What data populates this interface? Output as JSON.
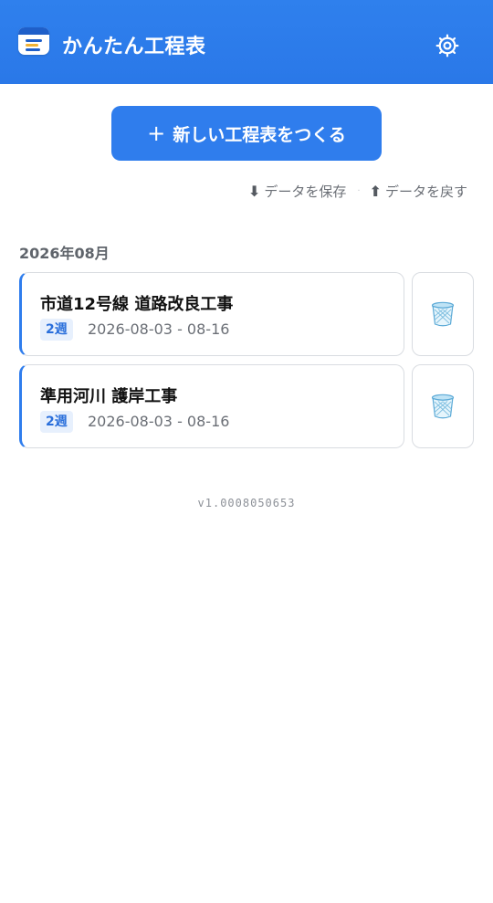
{
  "header": {
    "app_title": "かんたん工程表",
    "app_icon": "calendar-icon",
    "settings_icon": "gear-icon",
    "color": "#2f80ed"
  },
  "actions": {
    "new_button_icon": "+",
    "new_button_label": "新しい工程表をつくる",
    "save_icon": "⬇",
    "save_label": "データを保存",
    "separator": "·",
    "restore_icon": "⬆",
    "restore_label": "データを戻す"
  },
  "month_group": {
    "label": "2026年08月"
  },
  "projects": [
    {
      "title": "市道12号線 道路改良工事",
      "duration": "2週",
      "range": "2026-08-03 - 08-16",
      "delete_icon": "trash-icon"
    },
    {
      "title": "準用河川 護岸工事",
      "duration": "2週",
      "range": "2026-08-03 - 08-16",
      "delete_icon": "trash-icon"
    }
  ],
  "footer": {
    "version": "v1.0008050653"
  },
  "colors": {
    "accent": "#2f7ded",
    "badge_bg": "#e7f0fd",
    "badge_text": "#2a6fdb",
    "muted_text": "#6b6f76"
  }
}
